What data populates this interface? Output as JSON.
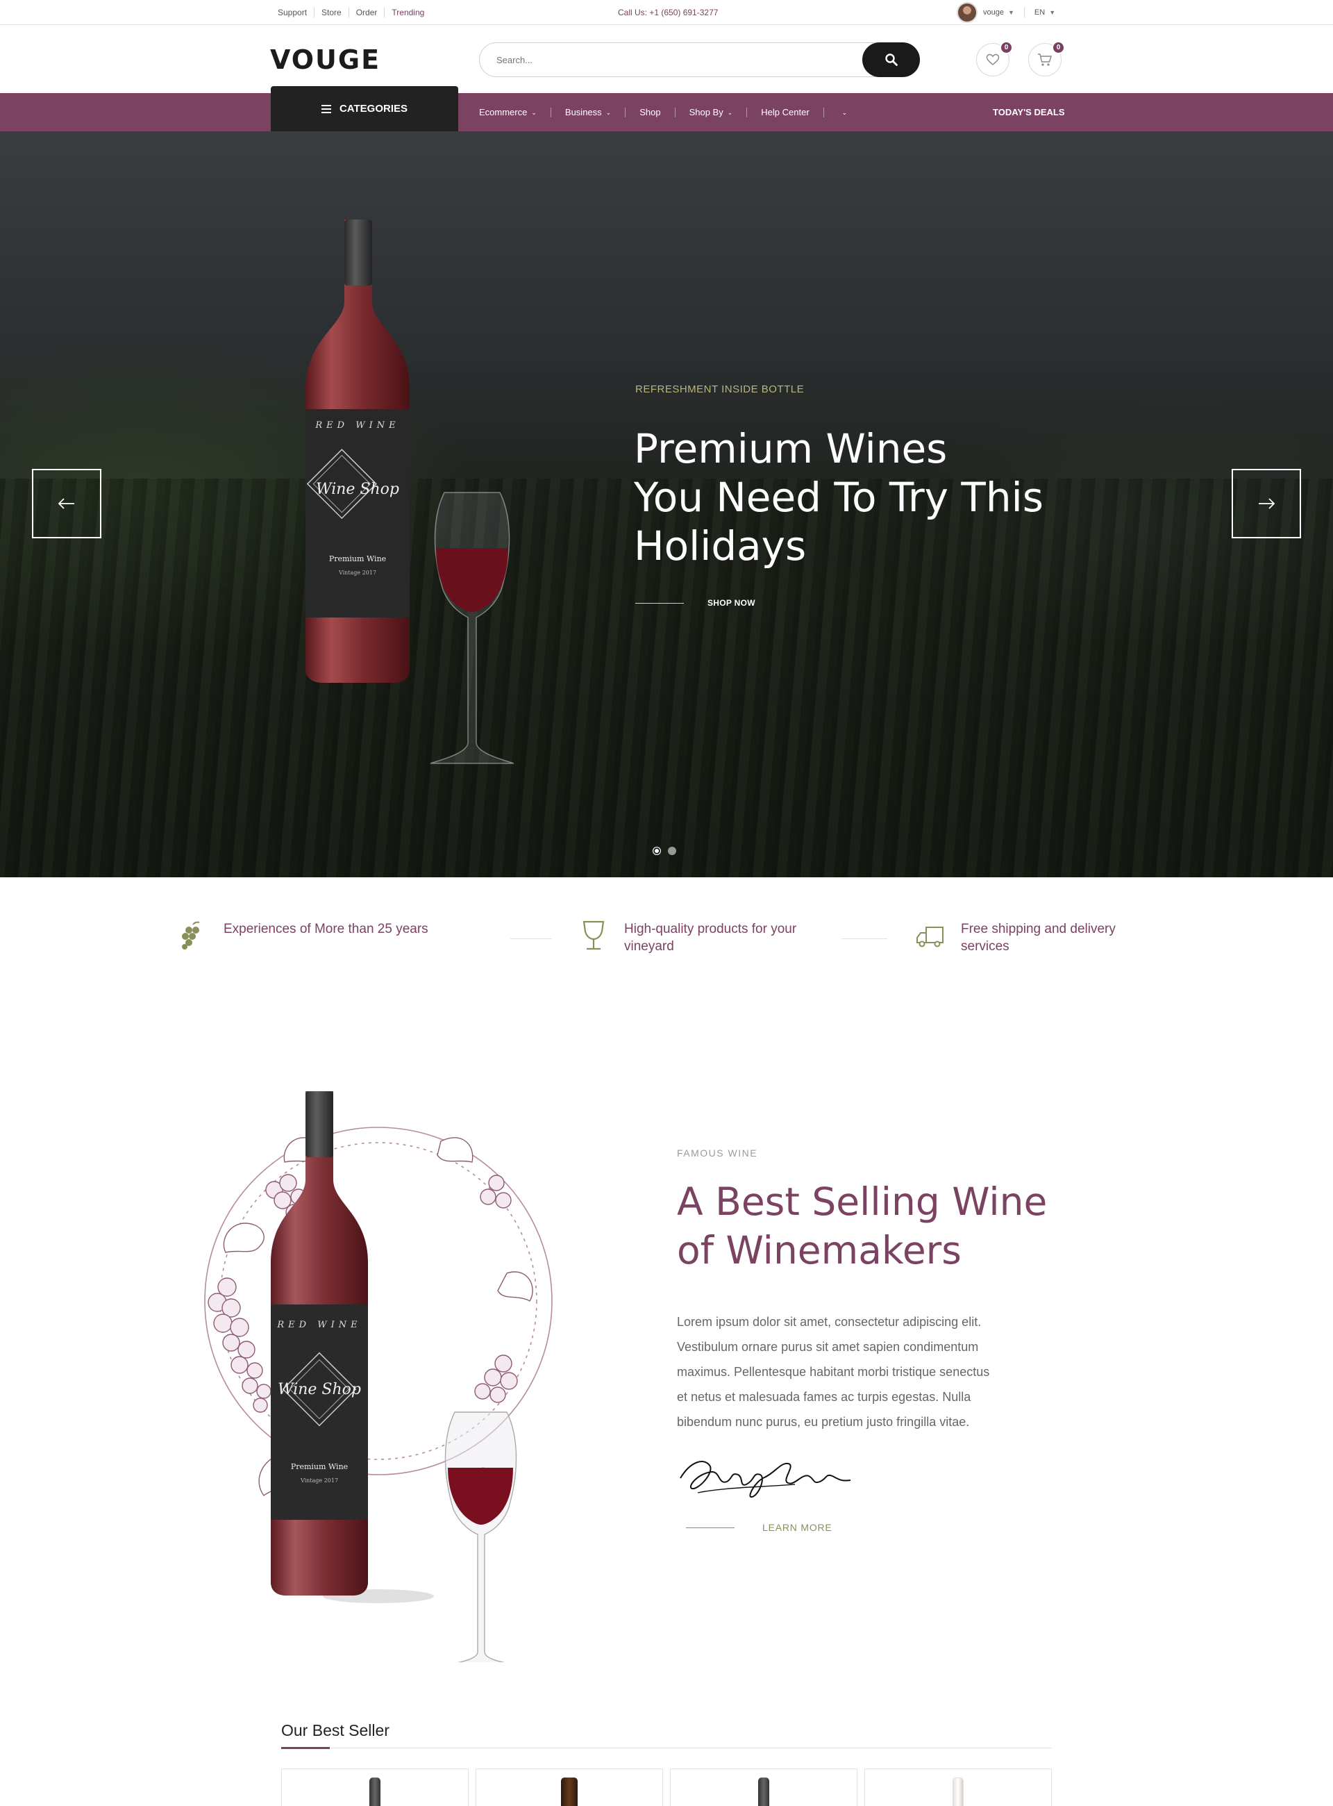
{
  "topbar": {
    "links": [
      "Support",
      "Store",
      "Order",
      "Trending"
    ],
    "call": "Call Us: +1 (650) 691-3277",
    "user": "vouge",
    "language": "EN"
  },
  "header": {
    "logo": "VOUGE",
    "search_placeholder": "Search...",
    "wishlist_count": "0",
    "cart_count": "0"
  },
  "nav": {
    "categories_label": "CATEGORIES",
    "items": [
      "Ecommerce",
      "Business",
      "Shop",
      "Shop By",
      "Help Center"
    ],
    "deals": "TODAY'S DEALS"
  },
  "hero": {
    "eyebrow": "REFRESHMENT INSIDE BOTTLE",
    "title_line1": "Premium Wines",
    "title_line2": "You Need To Try This",
    "title_line3": "Holidays",
    "cta": "SHOP NOW",
    "label_red": "RED WINE",
    "label_shop": "Wine Shop",
    "label_premium": "Premium Wine",
    "label_vintage": "Vintage 2017"
  },
  "features": [
    {
      "icon": "grapes-icon",
      "text_line1": "Experiences of More than 25 years",
      "text_line2": ""
    },
    {
      "icon": "wine-glass-icon",
      "text_line1": "High-quality products for your",
      "text_line2": "vineyard"
    },
    {
      "icon": "truck-icon",
      "text_line1": "Free shipping and delivery",
      "text_line2": "services"
    }
  ],
  "about": {
    "eyebrow": "FAMOUS WINE",
    "title_line1": "A Best Selling Wine",
    "title_line2": "of Winemakers",
    "body_lines": [
      "Lorem ipsum dolor sit amet, consectetur adipiscing elit.",
      "Vestibulum ornare purus sit amet sapien condimentum",
      "maximus. Pellentesque habitant morbi tristique senectus",
      "et netus et malesuada fames ac turpis egestas. Nulla",
      "bibendum nunc purus, eu pretium justo fringilla vitae."
    ],
    "cta": "LEARN MORE"
  },
  "best_seller": {
    "heading": "Our Best Seller"
  },
  "colors": {
    "brand": "#7b4262",
    "olive": "#8a8f5a",
    "dark": "#1a1a1a"
  }
}
